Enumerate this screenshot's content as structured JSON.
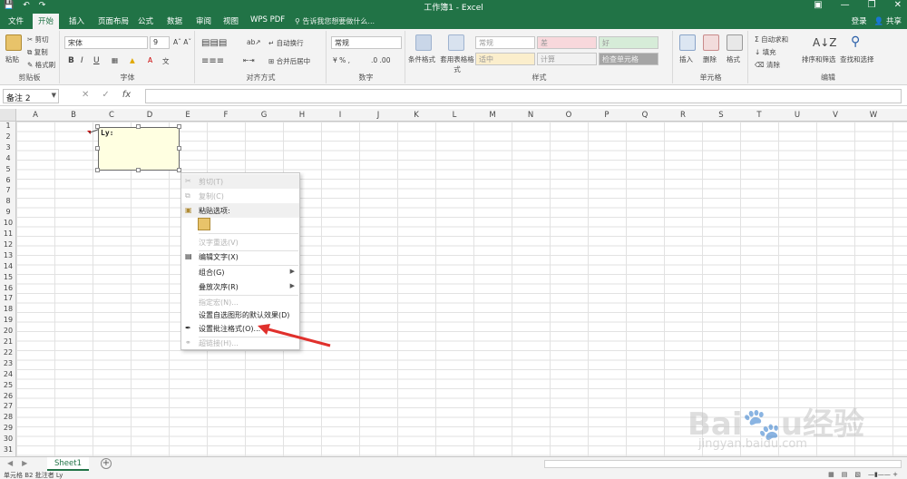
{
  "titlebar": {
    "title": "工作簿1 - Excel",
    "save_icon": "save-icon",
    "undo_icon": "undo-icon",
    "redo_icon": "redo-icon"
  },
  "tabs": [
    {
      "label": "文件"
    },
    {
      "label": "开始"
    },
    {
      "label": "插入"
    },
    {
      "label": "页面布局"
    },
    {
      "label": "公式"
    },
    {
      "label": "数据"
    },
    {
      "label": "审阅"
    },
    {
      "label": "视图"
    },
    {
      "label": "WPS PDF"
    }
  ],
  "tell_me": "告诉我您想要做什么...",
  "account": {
    "login": "登录",
    "share": "共享"
  },
  "ribbon": {
    "clipboard": {
      "paste": "粘贴",
      "cut": "剪切",
      "copy": "复制",
      "format_painter": "格式刷",
      "label": "剪贴板"
    },
    "font": {
      "name": "宋体",
      "size": "9",
      "bold": "B",
      "italic": "I",
      "underline": "U",
      "label": "字体"
    },
    "alignment": {
      "wrap": "自动换行",
      "merge": "合并后居中",
      "label": "对齐方式"
    },
    "number": {
      "format": "常规",
      "label": "数字"
    },
    "styles": {
      "conditional": "条件格式",
      "table": "套用表格格式",
      "cells": [
        "常规",
        "差",
        "好",
        "适中",
        "计算",
        "检查单元格"
      ],
      "label": "样式"
    },
    "cells_group": {
      "insert": "插入",
      "delete": "删除",
      "format": "格式",
      "label": "单元格"
    },
    "editing": {
      "autosum": "自动求和",
      "fill": "填充",
      "clear": "清除",
      "sort": "排序和筛选",
      "find": "查找和选择",
      "label": "编辑"
    }
  },
  "formula_bar": {
    "name_box": "备注 2",
    "fx": "fx",
    "formula": ""
  },
  "columns": [
    "A",
    "B",
    "C",
    "D",
    "E",
    "F",
    "G",
    "H",
    "I",
    "J",
    "K",
    "L",
    "M",
    "N",
    "O",
    "P",
    "Q",
    "R",
    "S",
    "T",
    "U",
    "V",
    "W"
  ],
  "rows": [
    "1",
    "2",
    "3",
    "4",
    "5",
    "6",
    "7",
    "8",
    "9",
    "10",
    "11",
    "12",
    "13",
    "14",
    "15",
    "16",
    "17",
    "18",
    "19",
    "20",
    "21",
    "22",
    "23",
    "24",
    "25",
    "26",
    "27",
    "28",
    "29",
    "30",
    "31"
  ],
  "comment": {
    "author": "Ly:"
  },
  "context_menu": [
    {
      "label": "剪切(T)",
      "disabled": true,
      "icon": "cut-icon"
    },
    {
      "label": "复制(C)",
      "disabled": true,
      "icon": "copy-icon"
    },
    {
      "label": "粘贴选项:",
      "disabled": false,
      "icon": "paste-icon"
    },
    {
      "label": "汉字重选(V)",
      "disabled": true
    },
    {
      "label": "编辑文字(X)",
      "disabled": false,
      "icon": "edit-text-icon"
    },
    {
      "label": "组合(G)",
      "disabled": false,
      "submenu": true
    },
    {
      "label": "叠放次序(R)",
      "disabled": false,
      "submenu": true
    },
    {
      "label": "指定宏(N)...",
      "disabled": true
    },
    {
      "label": "设置自选图形的默认效果(D)",
      "disabled": false
    },
    {
      "label": "设置批注格式(O)...",
      "disabled": false,
      "icon": "format-comment-icon"
    },
    {
      "label": "超链接(H)...",
      "disabled": true,
      "icon": "hyperlink-icon"
    }
  ],
  "sheets": [
    {
      "label": "Sheet1"
    }
  ],
  "status": {
    "message": "单元格 B2 批注者 Ly"
  },
  "watermark": {
    "logo": "Baidu经验",
    "url": "jingyan.baidu.com"
  },
  "colors": {
    "excel_green": "#217346",
    "comment_bg": "#ffffe1",
    "arrow": "#e0302c"
  }
}
